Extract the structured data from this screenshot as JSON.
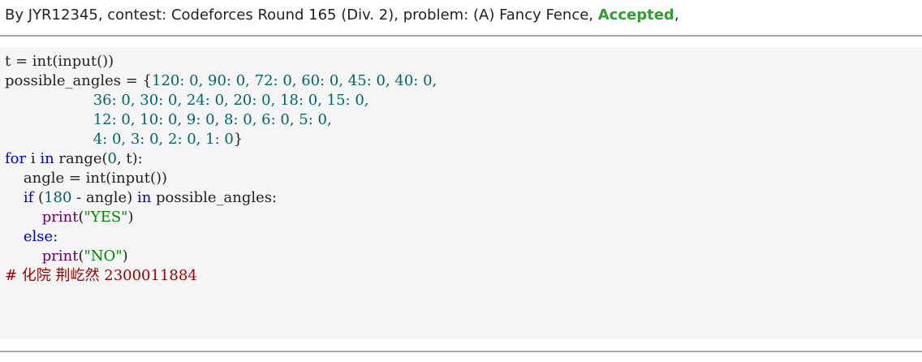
{
  "header": {
    "prefix": "By ",
    "author": "JYR12345",
    "contest_label": ", contest: ",
    "contest": "Codeforces Round 165 (Div. 2)",
    "problem_label": ", problem: ",
    "problem": "(A) Fancy Fence",
    "sep": ", ",
    "verdict": "Accepted",
    "trail": ","
  },
  "code": {
    "l1a": "t = int(input())",
    "l2a": "possible_angles = {",
    "l2b": "120: 0, 90: 0, 72: 0, 60: 0, 45: 0, 40: 0,",
    "l3": "36: 0, 30: 0, 24: 0, 20: 0, 18: 0, 15: 0,",
    "l4": "12: 0, 10: 0, 9: 0, 8: 0, 6: 0, 5: 0,",
    "l5a": "4: 0, 3: 0, 2: 0, 1: 0",
    "l5b": "}",
    "l6_kw1": "for",
    "l6_a": " i ",
    "l6_kw2": "in",
    "l6_b": " range(",
    "l6_n1": "0",
    "l6_c": ", t):",
    "l7": "angle = int(input())",
    "l8_kw1": "if",
    "l8_a": " (",
    "l8_n": "180",
    "l8_b": " - angle) ",
    "l8_kw2": "in",
    "l8_c": " possible_angles:",
    "l9_fn": "print",
    "l9_open": "(",
    "l9_str": "\"YES\"",
    "l9_close": ")",
    "l10_kw": "else",
    "l10_colon": ":",
    "l11_fn": "print",
    "l11_open": "(",
    "l11_str": "\"NO\"",
    "l11_close": ")",
    "l12": "# 化院 荆屹然 2300011884"
  }
}
